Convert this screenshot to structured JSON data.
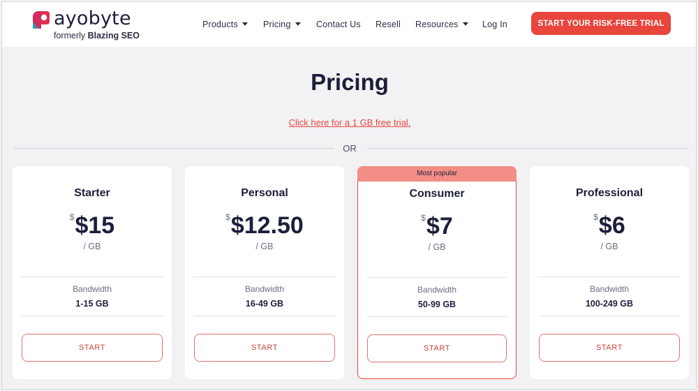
{
  "brand": {
    "name": "ayobyte",
    "subtitle_prefix": "formerly",
    "subtitle_brand": "Blazing SEO",
    "colors": {
      "accent": "#e8453c",
      "logo_red": "#e0314f",
      "logo_teal": "#2a9aa8"
    }
  },
  "nav": {
    "items": [
      {
        "label": "Products",
        "dropdown": true
      },
      {
        "label": "Pricing",
        "dropdown": true
      },
      {
        "label": "Contact Us",
        "dropdown": false
      },
      {
        "label": "Resell",
        "dropdown": false
      },
      {
        "label": "Resources",
        "dropdown": true
      },
      {
        "label": "Log In",
        "dropdown": false
      }
    ],
    "cta_label": "START YOUR RISK-FREE TRIAL"
  },
  "main": {
    "title": "Pricing",
    "trial_link": "Click here for a 1 GB free trial.",
    "or_label": "OR"
  },
  "plans": [
    {
      "name": "Starter",
      "currency": "$",
      "price": "$15",
      "unit": "/ GB",
      "bandwidth_label": "Bandwidth",
      "bandwidth": "1-15 GB",
      "button": "START",
      "badge": ""
    },
    {
      "name": "Personal",
      "currency": "$",
      "price": "$12.50",
      "unit": "/ GB",
      "bandwidth_label": "Bandwidth",
      "bandwidth": "16-49 GB",
      "button": "START",
      "badge": ""
    },
    {
      "name": "Consumer",
      "currency": "$",
      "price": "$7",
      "unit": "/ GB",
      "bandwidth_label": "Bandwidth",
      "bandwidth": "50-99 GB",
      "button": "START",
      "badge": "Most popular"
    },
    {
      "name": "Professional",
      "currency": "$",
      "price": "$6",
      "unit": "/ GB",
      "bandwidth_label": "Bandwidth",
      "bandwidth": "100-249 GB",
      "button": "START",
      "badge": ""
    }
  ]
}
